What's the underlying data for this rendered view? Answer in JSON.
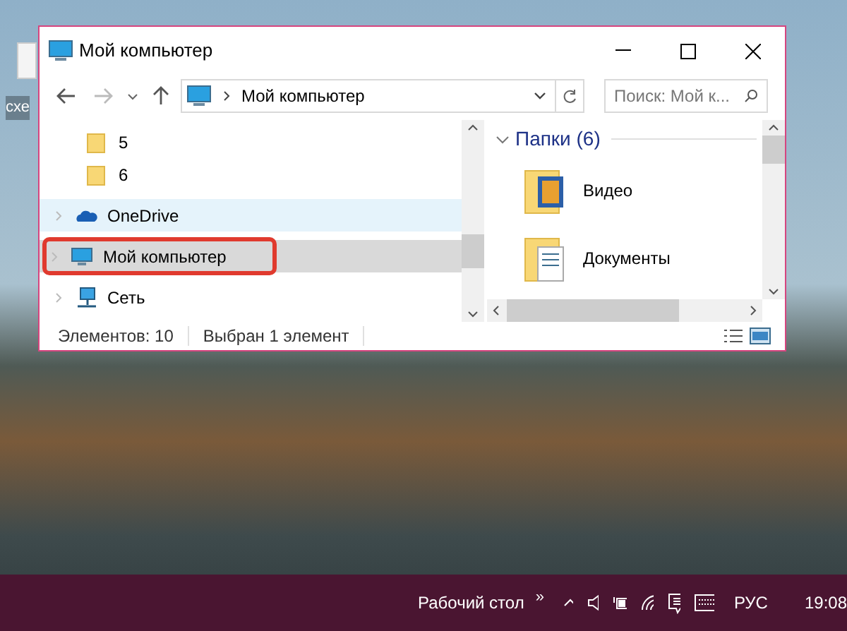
{
  "desktop": {
    "icons": [
      {
        "label": "схе"
      }
    ]
  },
  "window": {
    "title": "Мой компьютер",
    "address": {
      "path": "Мой компьютер"
    },
    "search": {
      "placeholder": "Поиск: Мой к..."
    },
    "nav_tree": [
      {
        "label": "5",
        "kind": "folder",
        "hovered": false,
        "selected": false,
        "annotated": false
      },
      {
        "label": "6",
        "kind": "folder",
        "hovered": false,
        "selected": false,
        "annotated": false
      },
      {
        "label": "OneDrive",
        "kind": "cloud",
        "hovered": true,
        "selected": false,
        "annotated": false
      },
      {
        "label": "Мой компьютер",
        "kind": "computer",
        "hovered": false,
        "selected": true,
        "annotated": true
      },
      {
        "label": "Сеть",
        "kind": "network",
        "hovered": false,
        "selected": false,
        "annotated": false
      }
    ],
    "group": {
      "title": "Папки (6)",
      "expanded": true
    },
    "items": [
      {
        "label": "Видео",
        "kind": "video"
      },
      {
        "label": "Документы",
        "kind": "documents"
      }
    ],
    "status_bar": {
      "count": "Элементов: 10",
      "selection": "Выбран 1 элемент"
    }
  },
  "taskbar": {
    "toolbar": "Рабочий стол",
    "more": "»",
    "language": "РУС",
    "time": "19:08"
  }
}
